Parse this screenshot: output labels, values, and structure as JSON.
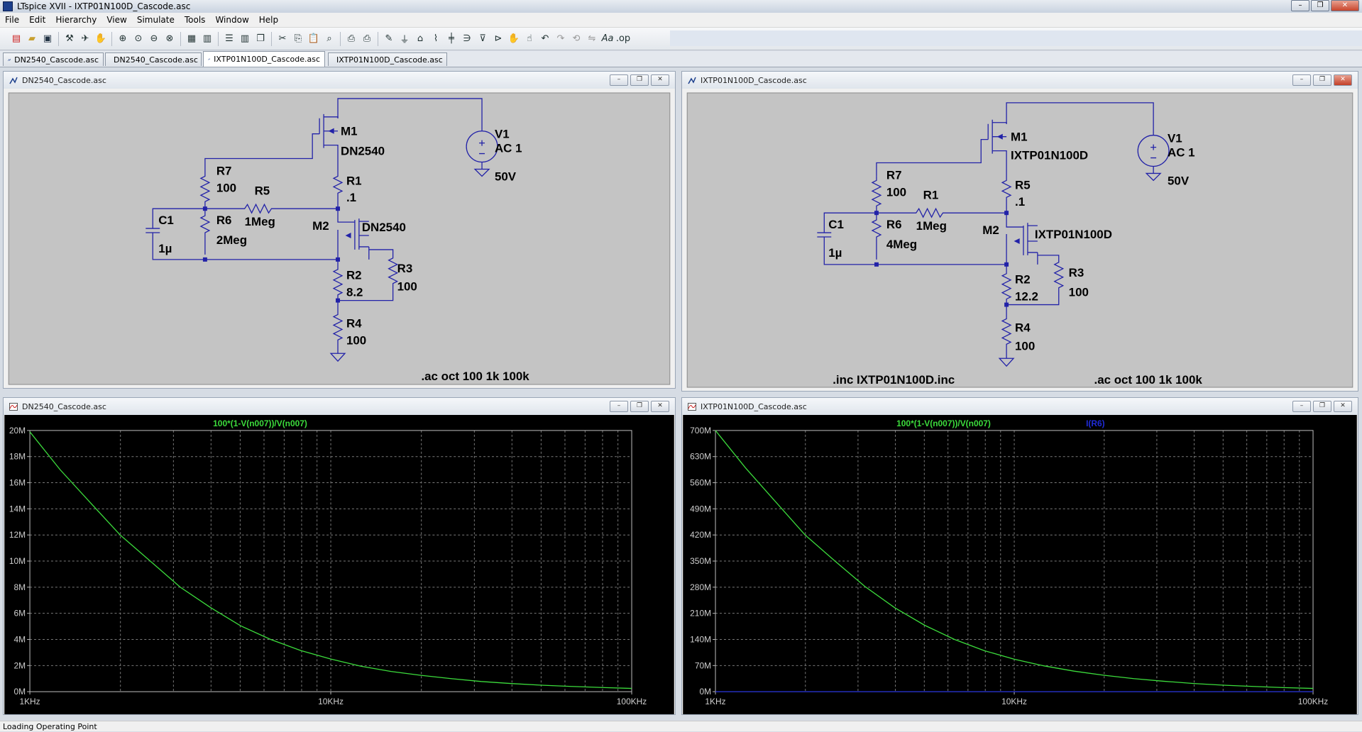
{
  "window": {
    "title": "LTspice XVII - IXTP01N100D_Cascode.asc"
  },
  "menu": [
    "File",
    "Edit",
    "Hierarchy",
    "View",
    "Simulate",
    "Tools",
    "Window",
    "Help"
  ],
  "tabs": [
    {
      "label": "DN2540_Cascode.asc",
      "icon": "schematic-icon"
    },
    {
      "label": "DN2540_Cascode.asc",
      "icon": "waveform-icon"
    },
    {
      "label": "IXTP01N100D_Cascode.asc",
      "icon": "schematic-icon"
    },
    {
      "label": "IXTP01N100D_Cascode.asc",
      "icon": "waveform-icon"
    }
  ],
  "schematic_left": {
    "caption": "DN2540_Cascode.asc",
    "M1": "M1",
    "M1_model": "DN2540",
    "M2": "M2",
    "M2_model": "DN2540",
    "R7": "R7",
    "R7_val": "100",
    "R5": "R5",
    "R5_val": "1Meg",
    "R6": "R6",
    "R6_val": "2Meg",
    "R1": "R1",
    "R1_val": ".1",
    "R2": "R2",
    "R2_val": "8.2",
    "R3": "R3",
    "R3_val": "100",
    "R4": "R4",
    "R4_val": "100",
    "C1": "C1",
    "C1_val": "1µ",
    "V1": "V1",
    "V1_ac": "AC 1",
    "V1_dc": "50V",
    "directive": ".ac oct 100 1k 100k"
  },
  "schematic_right": {
    "caption": "IXTP01N100D_Cascode.asc",
    "M1": "M1",
    "M1_model": "IXTP01N100D",
    "M2": "M2",
    "M2_model": "IXTP01N100D",
    "R7": "R7",
    "R7_val": "100",
    "R1": "R1",
    "R1_val": "1Meg",
    "R6": "R6",
    "R6_val": "4Meg",
    "R5": "R5",
    "R5_val": ".1",
    "R2": "R2",
    "R2_val": "12.2",
    "R3": "R3",
    "R3_val": "100",
    "R4": "R4",
    "R4_val": "100",
    "C1": "C1",
    "C1_val": "1µ",
    "V1": "V1",
    "V1_ac": "AC 1",
    "V1_dc": "50V",
    "include": ".inc IXTP01N100D.inc",
    "directive": ".ac oct 100 1k 100k"
  },
  "chart_data": [
    {
      "type": "line",
      "caption": "DN2540_Cascode.asc",
      "x_scale": "log",
      "xlim": [
        1000,
        100000
      ],
      "ylim": [
        0,
        20
      ],
      "x_ticks": [
        "1KHz",
        "10KHz",
        "100KHz"
      ],
      "y_ticks": [
        "0M",
        "2M",
        "4M",
        "6M",
        "8M",
        "10M",
        "12M",
        "14M",
        "16M",
        "18M",
        "20M"
      ],
      "grid": true,
      "series": [
        {
          "name": "100*(1-V(n007))/V(n007)",
          "color": "#3cdc3c",
          "x": [
            1000,
            1260,
            1585,
            1995,
            2512,
            3162,
            3981,
            5012,
            6310,
            7943,
            10000,
            12590,
            15850,
            19950,
            25120,
            31620,
            39810,
            50120,
            63100,
            79430,
            100000
          ],
          "y": [
            19.9,
            17.0,
            14.5,
            12.0,
            10.0,
            8.0,
            6.45,
            5.05,
            4.0,
            3.15,
            2.5,
            1.95,
            1.55,
            1.25,
            1.0,
            0.78,
            0.62,
            0.5,
            0.4,
            0.32,
            0.25
          ]
        }
      ]
    },
    {
      "type": "line",
      "caption": "IXTP01N100D_Cascode.asc",
      "x_scale": "log",
      "xlim": [
        1000,
        100000
      ],
      "ylim": [
        0,
        700
      ],
      "x_ticks": [
        "1KHz",
        "10KHz",
        "100KHz"
      ],
      "y_ticks": [
        "0M",
        "70M",
        "140M",
        "210M",
        "280M",
        "350M",
        "420M",
        "490M",
        "560M",
        "630M",
        "700M"
      ],
      "grid": true,
      "series": [
        {
          "name": "100*(1-V(n007))/V(n007)",
          "color": "#3cdc3c",
          "x": [
            1000,
            1260,
            1585,
            1995,
            2512,
            3162,
            3981,
            5012,
            6310,
            7943,
            10000,
            12590,
            15850,
            19950,
            25120,
            31620,
            39810,
            50120,
            63100,
            79430,
            100000
          ],
          "y": [
            700,
            600,
            510,
            420,
            350,
            282,
            225,
            178,
            140,
            110,
            87,
            69,
            55,
            44,
            35,
            28,
            22,
            17.5,
            14,
            11,
            8.7
          ]
        },
        {
          "name": "I(R6)",
          "color": "#1f2bd6",
          "x": [
            1000,
            100000
          ],
          "y": [
            0,
            0
          ]
        }
      ]
    }
  ],
  "status": {
    "text": "Loading Operating Point"
  }
}
